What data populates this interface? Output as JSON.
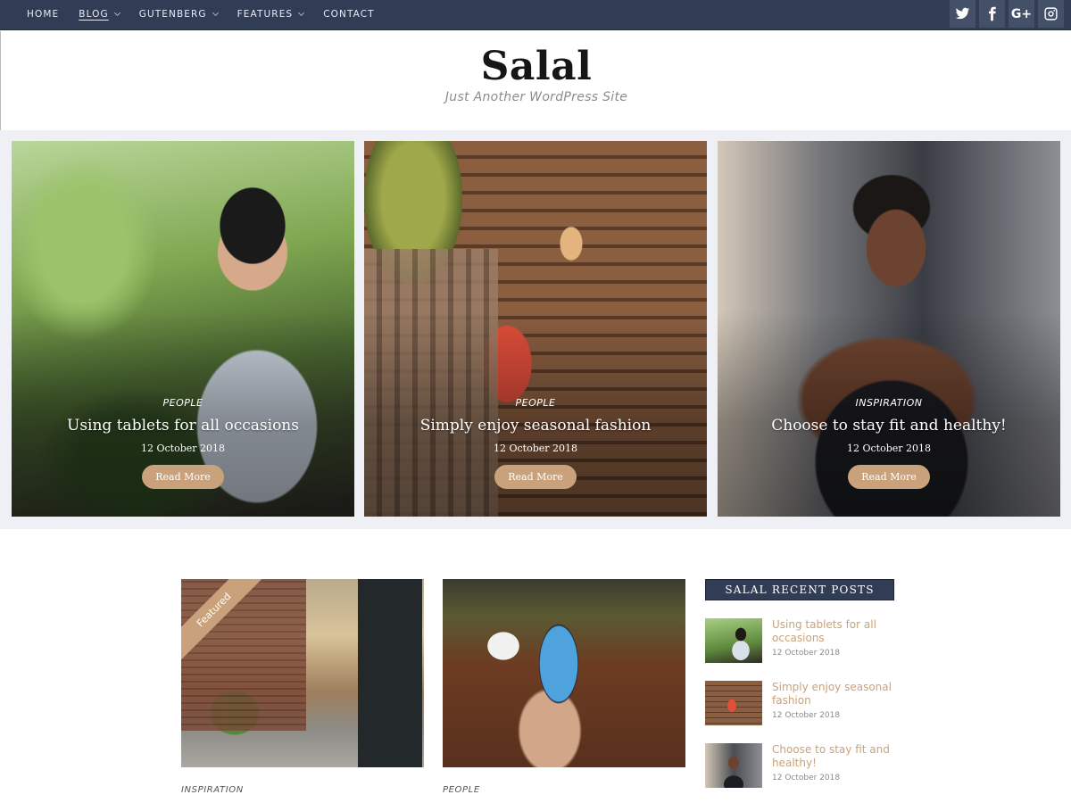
{
  "nav": {
    "items": [
      {
        "label": "Home",
        "has_dropdown": false,
        "active": false
      },
      {
        "label": "Blog",
        "has_dropdown": true,
        "active": true
      },
      {
        "label": "Gutenberg",
        "has_dropdown": true,
        "active": false
      },
      {
        "label": "Features",
        "has_dropdown": true,
        "active": false
      },
      {
        "label": "Contact",
        "has_dropdown": false,
        "active": false
      }
    ],
    "social": [
      {
        "name": "twitter-icon"
      },
      {
        "name": "facebook-icon"
      },
      {
        "name": "google-plus-icon",
        "glyph": "G+"
      },
      {
        "name": "instagram-icon"
      }
    ]
  },
  "header": {
    "title": "Salal",
    "tagline": "Just Another WordPress Site"
  },
  "slider": {
    "slides": [
      {
        "category": "People",
        "title": "Using tablets for all occasions",
        "date": "12 October 2018",
        "button": "Read More"
      },
      {
        "category": "People",
        "title": "Simply enjoy seasonal fashion",
        "date": "12 October 2018",
        "button": "Read More"
      },
      {
        "category": "Inspiration",
        "title": "Choose to stay fit and healthy!",
        "date": "12 October 2018",
        "button": "Read More"
      }
    ]
  },
  "posts": [
    {
      "category": "Inspiration",
      "featured_label": "Featured"
    },
    {
      "category": "People"
    }
  ],
  "sidebar": {
    "widget_title": "Salal Recent Posts",
    "recent_posts": [
      {
        "title": "Using tablets for all occasions",
        "date": "12 October 2018"
      },
      {
        "title": "Simply enjoy seasonal fashion",
        "date": "12 October 2018"
      },
      {
        "title": "Choose to stay fit and healthy!",
        "date": "12 October 2018"
      }
    ]
  },
  "colors": {
    "nav_bg": "#313c55",
    "accent": "#c9a27b",
    "slider_bg": "#eef0f5"
  }
}
